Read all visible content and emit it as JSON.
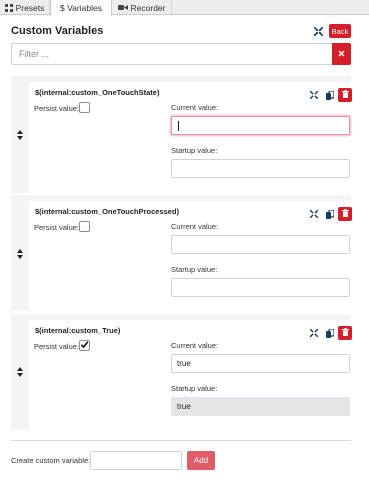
{
  "tabs": [
    {
      "label": "Presets",
      "icon": "grid-icon"
    },
    {
      "label": "$ Variables",
      "icon": "none",
      "active": true
    },
    {
      "label": "Recorder",
      "icon": "video-camera-icon"
    }
  ],
  "header": {
    "title": "Custom Variables",
    "back_label": "Back"
  },
  "filter": {
    "placeholder": "Filter ...",
    "value": ""
  },
  "variables": [
    {
      "name": "$(internal:custom_OneTouchState)",
      "persist_label": "Persist value:",
      "persist": false,
      "current_label": "Current value:",
      "current_value": "",
      "startup_label": "Startup value:",
      "startup_value": ""
    },
    {
      "name": "$(internal:custom_OneTouchProcessed)",
      "persist_label": "Persist value:",
      "persist": false,
      "current_label": "Current value:",
      "current_value": "",
      "startup_label": "Startup value:",
      "startup_value": ""
    },
    {
      "name": "$(internal:custom_True)",
      "persist_label": "Persist value:",
      "persist": true,
      "current_label": "Current value:",
      "current_value": "true",
      "startup_label": "Startup value:",
      "startup_value": "true"
    }
  ],
  "create": {
    "label": "Create custom variable:",
    "value": "",
    "add_label": "Add"
  },
  "colors": {
    "danger": "#d41f2b",
    "add_button": "#e05c66",
    "card_bg": "#f3f4f5",
    "icon_navy": "#1f3a5f"
  }
}
